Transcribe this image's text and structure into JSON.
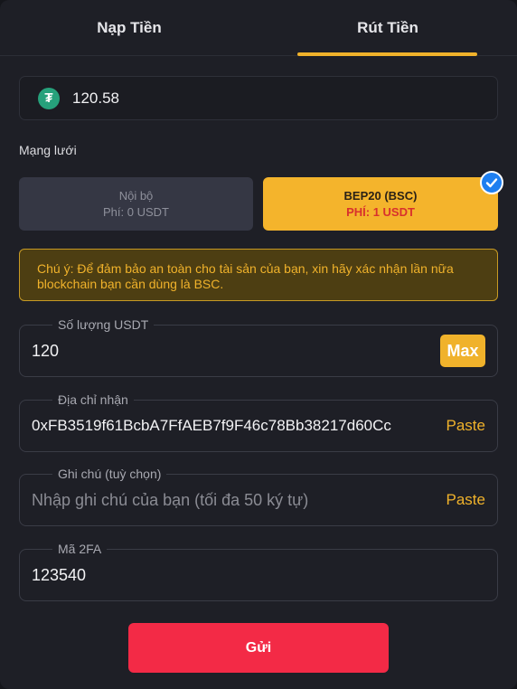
{
  "tabs": [
    {
      "label": "Nạp Tiền",
      "active": false
    },
    {
      "label": "Rút Tiền",
      "active": true
    }
  ],
  "balance": {
    "icon": "tether-icon",
    "value": "120.58"
  },
  "network": {
    "label": "Mạng lưới",
    "options": [
      {
        "name": "Nội bộ",
        "fee": "Phí: 0 USDT",
        "selected": false
      },
      {
        "name": "BEP20 (BSC)",
        "fee": "PHÍ: 1 USDT",
        "selected": true
      }
    ]
  },
  "warning": {
    "text": "Chú ý: Để đảm bảo an toàn cho tài sản của bạn, xin hãy xác nhận lần nữa blockchain bạn cần dùng là BSC."
  },
  "fields": {
    "amount": {
      "legend": "Số lượng USDT",
      "value": "120",
      "max_label": "Max"
    },
    "address": {
      "legend": "Địa chỉ nhận",
      "value": "0xFB3519f61BcbA7FfAEB7f9F46c78Bb38217d60Cc",
      "paste_label": "Paste"
    },
    "note": {
      "legend": "Ghi chú (tuỳ chọn)",
      "placeholder": "Nhập ghi chú của bạn (tối đa 50 ký tự)",
      "paste_label": "Paste"
    },
    "twofa": {
      "legend": "Mã 2FA",
      "value": "123540"
    }
  },
  "submit": {
    "label": "Gửi"
  },
  "colors": {
    "accent": "#f0b22b",
    "danger": "#f32a46",
    "selected_badge": "#1e7ff0",
    "tether": "#26a17b"
  }
}
